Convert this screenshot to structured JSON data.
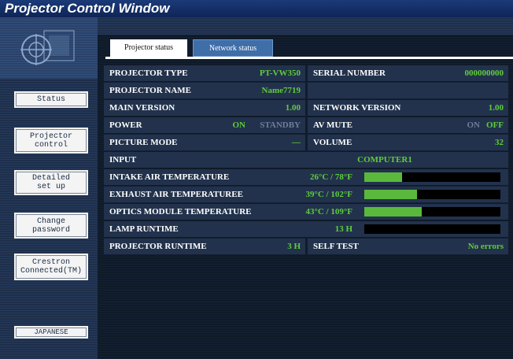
{
  "window": {
    "title": "Projector Control Window"
  },
  "sidebar": {
    "logo_icon": "projector-crosshair-logo",
    "items": [
      {
        "key": "status",
        "label": "Status"
      },
      {
        "key": "projector-control",
        "label": "Projector\ncontrol"
      },
      {
        "key": "detailed-setup",
        "label": "Detailed\nset up"
      },
      {
        "key": "change-password",
        "label": "Change\npassword"
      },
      {
        "key": "crestron",
        "label": "Crestron\nConnected(TM)"
      }
    ],
    "language_button": "JAPANESE"
  },
  "tabs": [
    {
      "label": "Projector status",
      "active": true
    },
    {
      "label": "Network status",
      "active": false
    }
  ],
  "status": {
    "projector_type": {
      "label": "PROJECTOR TYPE",
      "value": "PT-VW350"
    },
    "serial_number": {
      "label": "SERIAL NUMBER",
      "value": "000000000"
    },
    "projector_name": {
      "label": "PROJECTOR NAME",
      "value": "Name7719"
    },
    "main_version": {
      "label": "MAIN VERSION",
      "value": "1.00"
    },
    "network_version": {
      "label": "NETWORK VERSION",
      "value": "1.00"
    },
    "power": {
      "label": "POWER",
      "on": "ON",
      "standby": "STANDBY"
    },
    "av_mute": {
      "label": "AV MUTE",
      "on": "ON",
      "off": "OFF"
    },
    "picture_mode": {
      "label": "PICTURE MODE",
      "value": "—"
    },
    "volume": {
      "label": "VOLUME",
      "value": "32"
    },
    "input": {
      "label": "INPUT",
      "value": "COMPUTER1"
    },
    "intake_temp": {
      "label": "INTAKE AIR TEMPERATURE",
      "value": "26°C / 78°F",
      "level": 0.28
    },
    "exhaust_temp": {
      "label": "EXHAUST AIR TEMPERATUREE",
      "value": "39°C / 102°F",
      "level": 0.39
    },
    "optics_temp": {
      "label": "OPTICS MODULE TEMPERATURE",
      "value": "43°C / 109°F",
      "level": 0.42
    },
    "lamp_runtime": {
      "label": "LAMP RUNTIME",
      "value": "13 H",
      "level": 0.0
    },
    "projector_runtime": {
      "label": "PROJECTOR RUNTIME",
      "value": "3 H"
    },
    "self_test": {
      "label": "SELF TEST",
      "value": "No errors"
    }
  },
  "colors": {
    "value_green": "#5fcd3b",
    "bar_green": "#5ab93d",
    "title_bg": "#1b3a78"
  }
}
